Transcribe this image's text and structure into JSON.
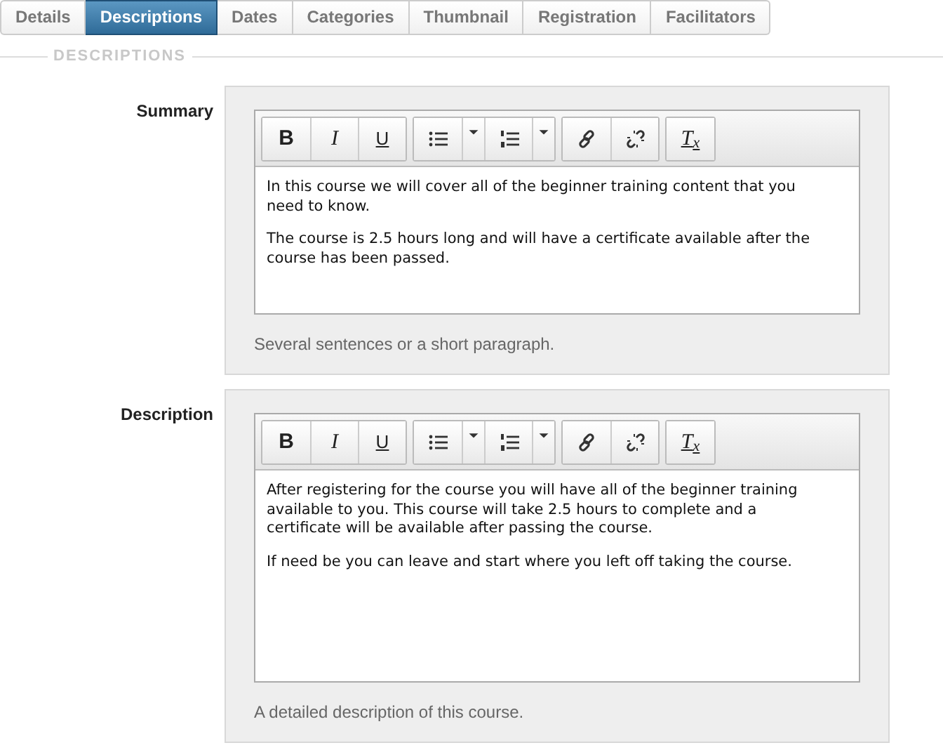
{
  "tabs": [
    {
      "label": "Details",
      "selected": false
    },
    {
      "label": "Descriptions",
      "selected": true
    },
    {
      "label": "Dates",
      "selected": false
    },
    {
      "label": "Categories",
      "selected": false
    },
    {
      "label": "Thumbnail",
      "selected": false
    },
    {
      "label": "Registration",
      "selected": false
    },
    {
      "label": "Facilitators",
      "selected": false
    }
  ],
  "section_legend": "DESCRIPTIONS",
  "fields": [
    {
      "label": "Summary",
      "toolbar": [
        [
          {
            "kind": "bold",
            "label": "B"
          },
          {
            "kind": "italic",
            "label": "I"
          },
          {
            "kind": "underline",
            "label": "U"
          }
        ],
        [
          {
            "kind": "bulleted-list"
          },
          {
            "kind": "dropdown"
          },
          {
            "kind": "numbered-list"
          },
          {
            "kind": "dropdown"
          }
        ],
        [
          {
            "kind": "link"
          },
          {
            "kind": "unlink"
          }
        ],
        [
          {
            "kind": "remove-format",
            "label": "T$_{x}$"
          }
        ]
      ],
      "paragraphs": [
        "In this course we will cover all of the beginner training content that you need to know.",
        "The course is 2.5 hours long and will have a certificate available after the course has been passed."
      ],
      "help": "Several sentences or a short paragraph."
    },
    {
      "label": "Description",
      "toolbar": [
        [
          {
            "kind": "bold",
            "label": "B"
          },
          {
            "kind": "italic",
            "label": "I"
          },
          {
            "kind": "underline",
            "label": "U"
          }
        ],
        [
          {
            "kind": "bulleted-list"
          },
          {
            "kind": "dropdown"
          },
          {
            "kind": "numbered-list"
          },
          {
            "kind": "dropdown"
          }
        ],
        [
          {
            "kind": "link"
          },
          {
            "kind": "unlink"
          }
        ],
        [
          {
            "kind": "remove-format",
            "label": "T$_{x}$"
          }
        ]
      ],
      "paragraphs": [
        "After registering for the course you will have all of the beginner training available to you. This course will take 2.5 hours to complete and a certificate will be available after passing the course.",
        "If need be you can leave and start where you left off taking the course."
      ],
      "help": "A detailed description of this course."
    }
  ]
}
